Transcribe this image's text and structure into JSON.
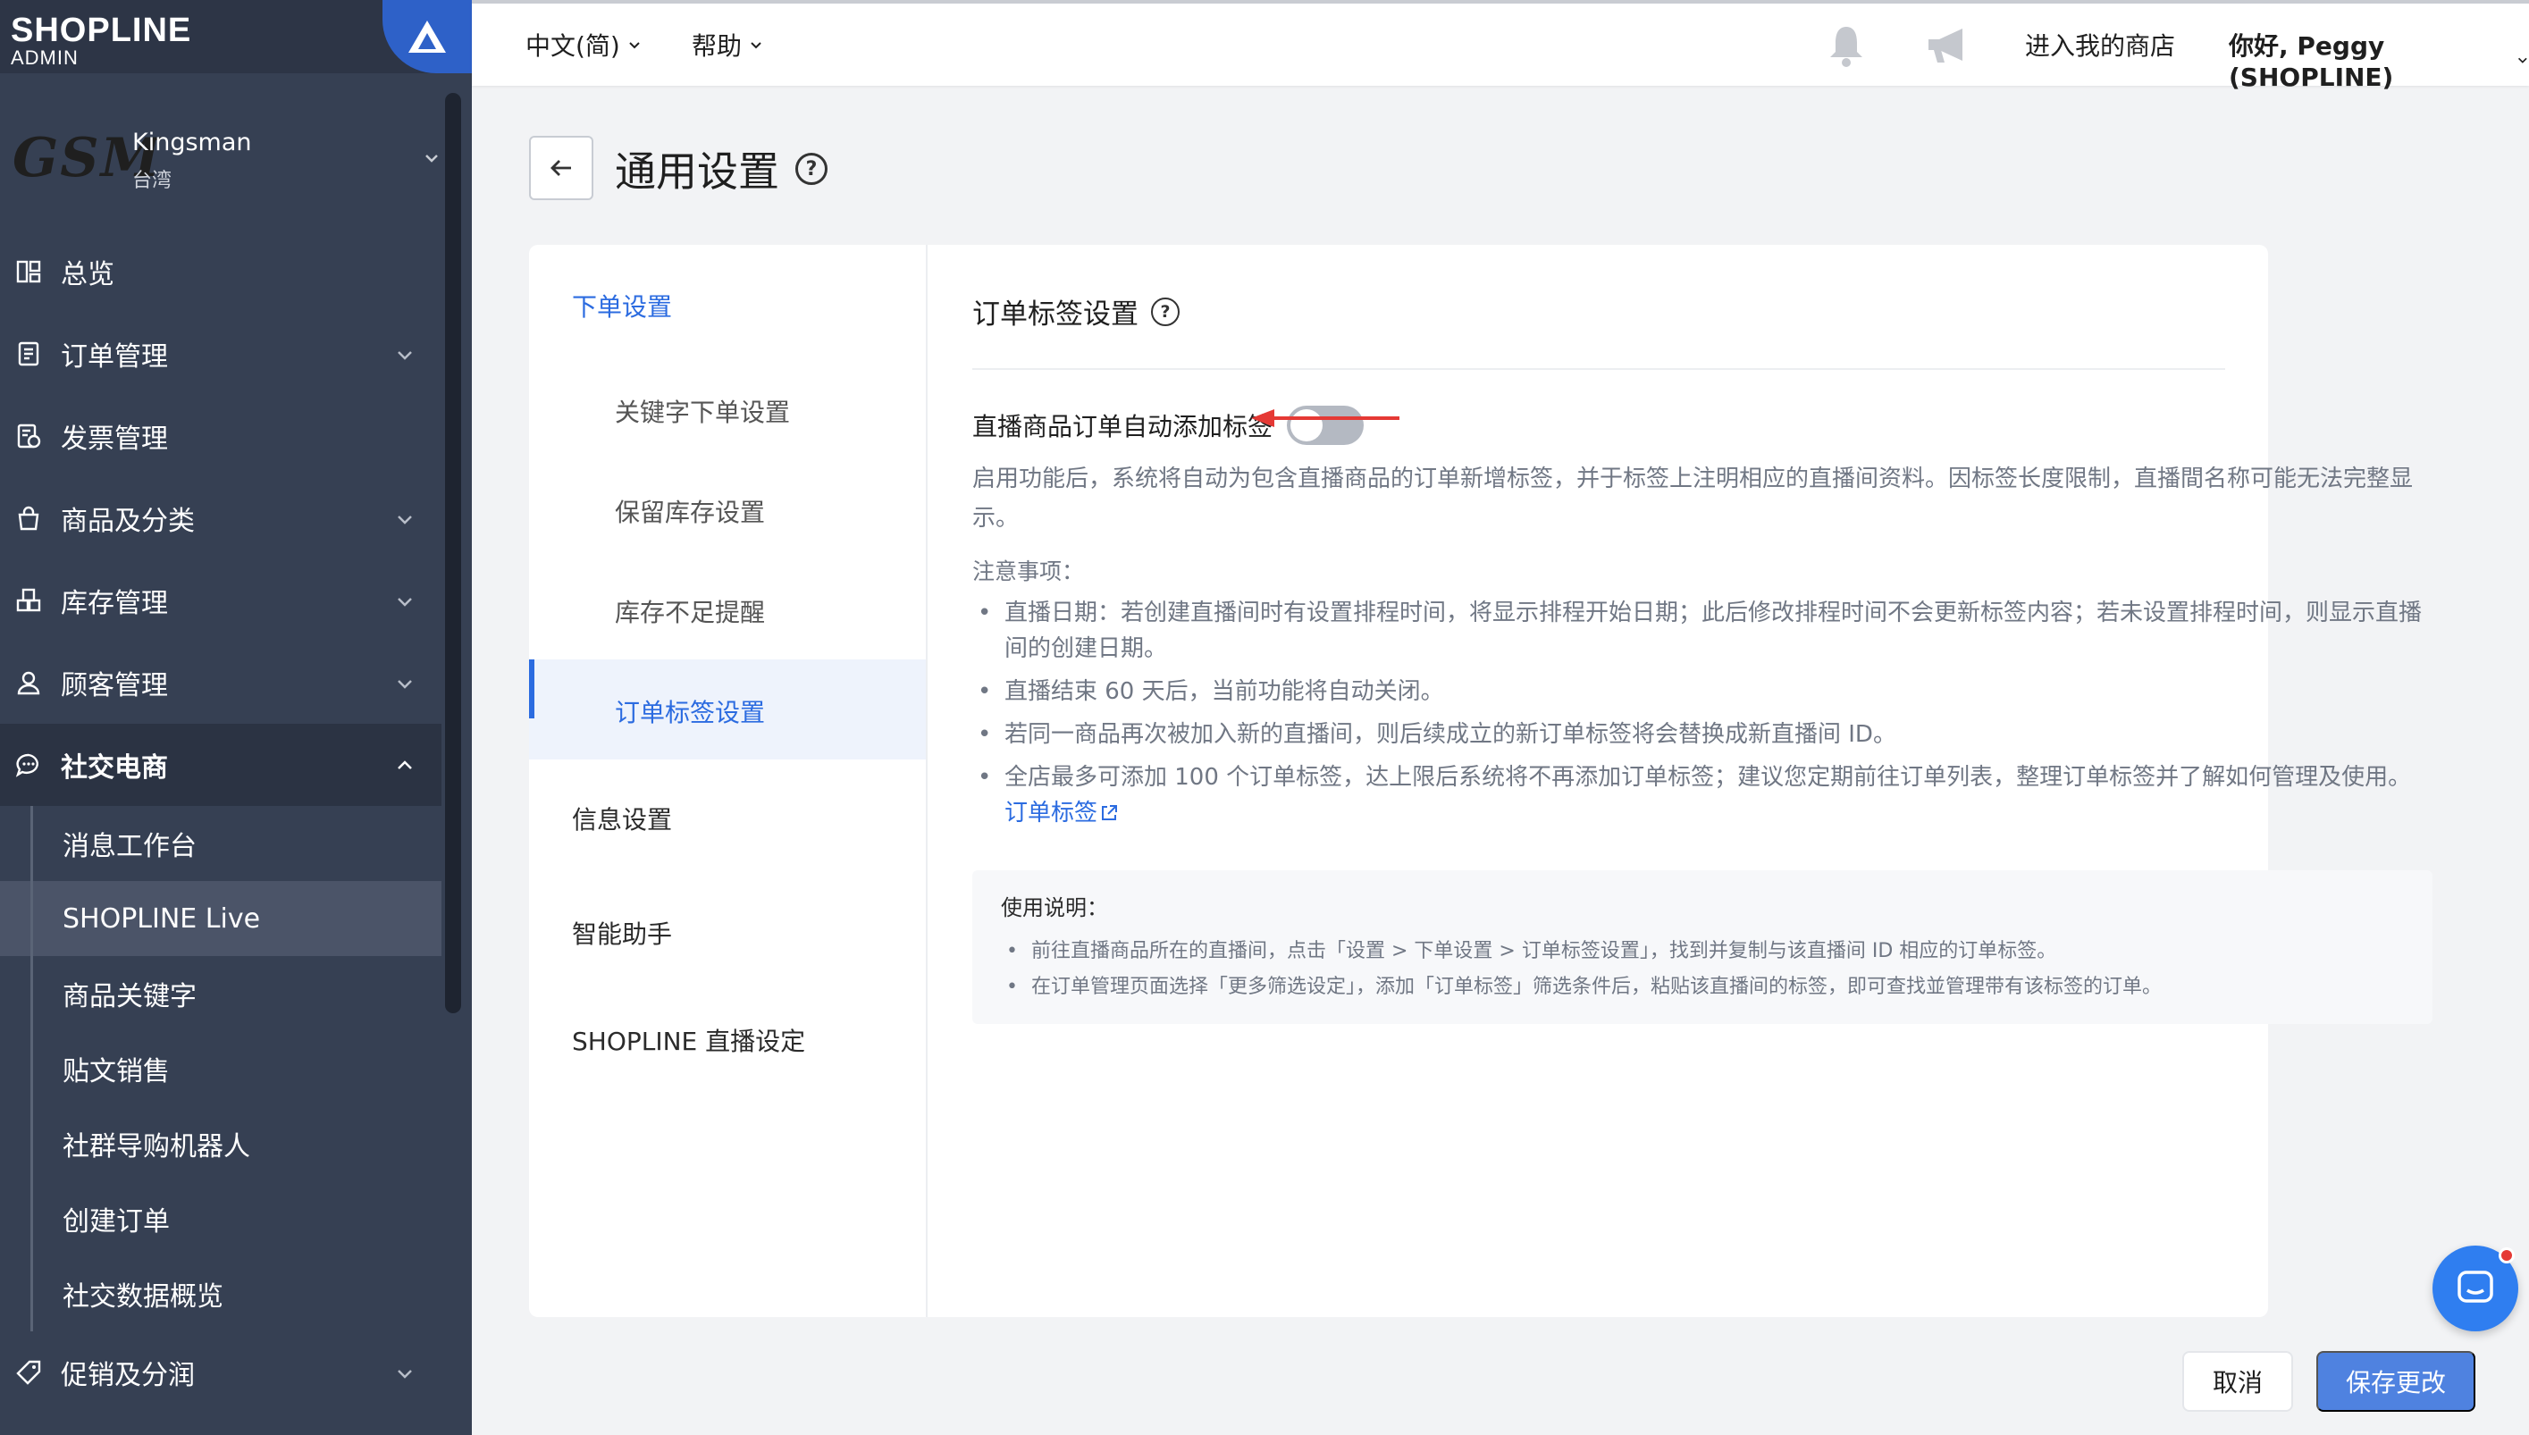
{
  "colors": {
    "sidebar_bg": "#364053",
    "accent": "#2b6be0",
    "save_button": "#4f82e0",
    "annotation_arrow": "#e53935"
  },
  "brand": {
    "line1": "SHOPLINE",
    "line2": "ADMIN"
  },
  "store": {
    "logo_text": "GSM",
    "name": "Kingsman",
    "region": "台湾"
  },
  "sidebar": {
    "items": [
      {
        "label": "总览",
        "icon": "dashboard-icon",
        "chevron": false
      },
      {
        "label": "订单管理",
        "icon": "order-icon",
        "chevron": true
      },
      {
        "label": "发票管理",
        "icon": "invoice-icon",
        "chevron": false
      },
      {
        "label": "商品及分类",
        "icon": "bag-icon",
        "chevron": true
      },
      {
        "label": "库存管理",
        "icon": "inventory-icon",
        "chevron": true
      },
      {
        "label": "顾客管理",
        "icon": "user-icon",
        "chevron": true
      },
      {
        "label": "社交电商",
        "icon": "chat-bubble-icon",
        "chevron": true,
        "expanded": true
      }
    ],
    "sub_items": [
      "消息工作台",
      "SHOPLINE Live",
      "商品关键字",
      "贴文销售",
      "社群导购机器人",
      "创建订单",
      "社交数据概览"
    ],
    "active_sub_item": "SHOPLINE Live",
    "after_items": [
      {
        "label": "促销及分润",
        "icon": "tag-icon",
        "chevron": true
      }
    ]
  },
  "topbar": {
    "language": "中文(简)",
    "help": "帮助",
    "enter_store": "进入我的商店",
    "greeting": "你好, Peggy (SHOPLINE)"
  },
  "page": {
    "title": "通用设置"
  },
  "left_nav": {
    "group1": "下单设置",
    "children": [
      "关键字下单设置",
      "保留库存设置",
      "库存不足提醒",
      "订单标签设置"
    ],
    "active": "订单标签设置",
    "group2": "信息设置",
    "group3": "智能助手",
    "group4": "SHOPLINE 直播设定"
  },
  "section": {
    "title": "订单标签设置",
    "toggle_label": "直播商品订单自动添加标签",
    "toggle_on": false,
    "description": "启用功能后，系统将自动为包含直播商品的订单新增标签，并于标签上注明相应的直播间资料。因标签长度限制，直播間名称可能无法完整显示。",
    "notes_title": "注意事项：",
    "notes": [
      "直播日期：若创建直播间时有设置排程时间，将显示排程开始日期；此后修改排程时间不会更新标签内容；若未设置排程时间，则显示直播间的创建日期。",
      "直播结束 60 天后，当前功能将自动关闭。",
      "若同一商品再次被加入新的直播间，则后续成立的新订单标签将会替换成新直播间 ID。",
      "全店最多可添加 100 个订单标签，达上限后系统将不再添加订单标签；建议您定期前往订单列表，整理订单标签并了解如何管理及使用。"
    ],
    "notes_link": "订单标签",
    "usage_title": "使用说明：",
    "usage": [
      "前往直播商品所在的直播间，点击「设置 > 下单设置 > 订单标签设置」，找到并复制与该直播间 ID 相应的订单标签。",
      "在订单管理页面选择「更多筛选设定」，添加「订单标签」筛选条件后，粘贴该直播间的标签，即可查找並管理带有该标签的订单。"
    ]
  },
  "footer": {
    "cancel": "取消",
    "save": "保存更改"
  }
}
